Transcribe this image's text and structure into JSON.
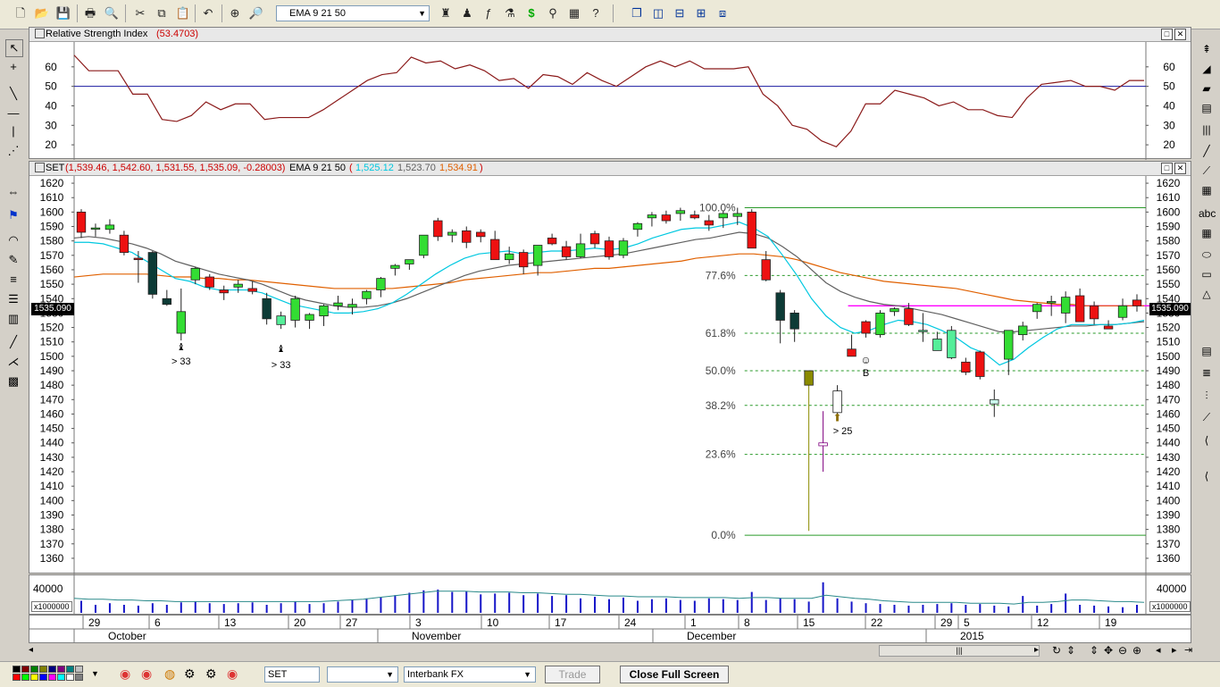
{
  "toolbar": {
    "indicator_combo_value": "EMA 9 21 50"
  },
  "rsi_pane": {
    "title_prefix": "Relative Strength Index",
    "title_value": "(53.4703)",
    "y_ticks": [
      "60",
      "50",
      "40",
      "30",
      "20"
    ],
    "ref_line": 50
  },
  "price_pane": {
    "title_symbol": "SET",
    "title_ohlc": "(1,539.46, 1,542.60, 1,531.55, 1,535.09, -0.28003)",
    "title_ema_label": "EMA 9 21 50",
    "title_ema_open": "(",
    "title_ema1": "1,525.12",
    "title_ema2": "1,523.70",
    "title_ema3": "1,534.91",
    "title_ema_close": ")",
    "current_price": "1535.090",
    "y_ticks": [
      "1620",
      "1610",
      "1600",
      "1590",
      "1580",
      "1570",
      "1560",
      "1550",
      "1540",
      "1530",
      "1520",
      "1510",
      "1500",
      "1490",
      "1480",
      "1470",
      "1460",
      "1450",
      "1440",
      "1430",
      "1420",
      "1410",
      "1400",
      "1390",
      "1380",
      "1370",
      "1360"
    ],
    "fib_labels": [
      "100.0%",
      "77.6%",
      "61.8%",
      "50.0%",
      "38.2%",
      "23.6%",
      "0.0%"
    ],
    "annotations": [
      "> 33",
      "> 33",
      "B",
      "> 25"
    ]
  },
  "volume_pane": {
    "y_tick": "40000",
    "multiplier": "x1000000"
  },
  "date_axis": {
    "days": [
      "29",
      "6",
      "13",
      "20",
      "27",
      "3",
      "10",
      "17",
      "24",
      "1",
      "8",
      "15",
      "22",
      "29",
      "5",
      "12",
      "19"
    ],
    "months": [
      "October",
      "November",
      "December",
      "2015"
    ]
  },
  "bottombar": {
    "symbol": "SET",
    "period": "",
    "source": "Interbank FX",
    "trade_label": "Trade",
    "close_full_screen_label": "Close Full Screen"
  },
  "colors": {
    "rsi_line": "#8b1a1a",
    "ema9": "#00c8e0",
    "ema21": "#606060",
    "ema50": "#e06000",
    "up_candle": "#33dd33",
    "down_candle": "#ee1111",
    "fib_line": "#2a9a2a",
    "volume_bar": "#1515c8",
    "volume_avg": "#2a8a8a"
  },
  "chart_data": {
    "type": "line",
    "title": "SET",
    "rsi": [
      66,
      58,
      58,
      58,
      46,
      46,
      33,
      32,
      35,
      42,
      38,
      41,
      41,
      33,
      34,
      34,
      34,
      38,
      43,
      48,
      53,
      56,
      57,
      65,
      62,
      63,
      59,
      61,
      58,
      53,
      54,
      49,
      56,
      55,
      51,
      57,
      53,
      50,
      55,
      60,
      63,
      60,
      63,
      59,
      59,
      59,
      60,
      46,
      40,
      30,
      28,
      22,
      19,
      27,
      41,
      41,
      48,
      46,
      44,
      40,
      42,
      38,
      38,
      35,
      34,
      44,
      51,
      52,
      53,
      50,
      50,
      48,
      53,
      53
    ],
    "price_ohlc": [
      [
        1600,
        1602,
        1582,
        1586
      ],
      [
        1589,
        1592,
        1583,
        1589
      ],
      [
        1588,
        1595,
        1585,
        1591
      ],
      [
        1584,
        1587,
        1570,
        1572
      ],
      [
        1568,
        1573,
        1551,
        1567
      ],
      [
        1572,
        1573,
        1540,
        1543
      ],
      [
        1540,
        1546,
        1535,
        1536
      ],
      [
        1516,
        1547,
        1511,
        1531
      ],
      [
        1553,
        1562,
        1550,
        1561
      ],
      [
        1555,
        1557,
        1546,
        1548
      ],
      [
        1546,
        1549,
        1539,
        1544
      ],
      [
        1548,
        1553,
        1544,
        1550
      ],
      [
        1547,
        1552,
        1543,
        1545
      ],
      [
        1540,
        1544,
        1522,
        1526
      ],
      [
        1522,
        1531,
        1519,
        1528
      ],
      [
        1525,
        1542,
        1520,
        1540
      ],
      [
        1525,
        1530,
        1519,
        1529
      ],
      [
        1528,
        1536,
        1521,
        1535
      ],
      [
        1535,
        1542,
        1532,
        1537
      ],
      [
        1534,
        1540,
        1529,
        1536
      ],
      [
        1540,
        1546,
        1536,
        1545
      ],
      [
        1546,
        1555,
        1541,
        1554
      ],
      [
        1561,
        1564,
        1556,
        1563
      ],
      [
        1564,
        1567,
        1560,
        1567
      ],
      [
        1570,
        1584,
        1568,
        1584
      ],
      [
        1594,
        1596,
        1580,
        1583
      ],
      [
        1584,
        1588,
        1579,
        1586
      ],
      [
        1587,
        1590,
        1575,
        1579
      ],
      [
        1586,
        1588,
        1579,
        1583
      ],
      [
        1581,
        1587,
        1567,
        1567
      ],
      [
        1567,
        1576,
        1564,
        1571
      ],
      [
        1572,
        1574,
        1557,
        1562
      ],
      [
        1563,
        1566,
        1556,
        1577
      ],
      [
        1582,
        1585,
        1577,
        1578
      ],
      [
        1576,
        1580,
        1567,
        1569
      ],
      [
        1569,
        1585,
        1568,
        1578
      ],
      [
        1585,
        1587,
        1575,
        1578
      ],
      [
        1580,
        1583,
        1567,
        1569
      ],
      [
        1570,
        1582,
        1568,
        1580
      ],
      [
        1588,
        1593,
        1583,
        1592
      ],
      [
        1596,
        1600,
        1590,
        1598
      ],
      [
        1598,
        1601,
        1592,
        1594
      ],
      [
        1599,
        1603,
        1594,
        1601
      ],
      [
        1598,
        1601,
        1595,
        1596
      ],
      [
        1594,
        1598,
        1587,
        1591
      ],
      [
        1596,
        1601,
        1589,
        1599
      ],
      [
        1597,
        1603,
        1591,
        1599
      ],
      [
        1600,
        1602,
        1583,
        1575
      ],
      [
        1567,
        1573,
        1552,
        1553
      ],
      [
        1544,
        1546,
        1509,
        1525
      ],
      [
        1530,
        1532,
        1510,
        1519
      ],
      [
        1490,
        1489,
        1379,
        1480
      ],
      [
        1440,
        1462,
        1420,
        1438
      ],
      [
        1461,
        1480,
        1456,
        1476
      ],
      [
        1505,
        1515,
        1500,
        1500
      ],
      [
        1524,
        1525,
        1513,
        1516
      ],
      [
        1515,
        1532,
        1513,
        1530
      ],
      [
        1531,
        1534,
        1528,
        1533
      ],
      [
        1533,
        1537,
        1521,
        1522
      ],
      [
        1518,
        1530,
        1510,
        1518
      ],
      [
        1512,
        1517,
        1505,
        1504
      ],
      [
        1518,
        1521,
        1498,
        1499
      ],
      [
        1496,
        1499,
        1487,
        1489
      ],
      [
        1503,
        1504,
        1484,
        1486
      ],
      [
        1470,
        1477,
        1458,
        1467
      ],
      [
        1498,
        1518,
        1487,
        1518
      ],
      [
        1515,
        1524,
        1511,
        1521
      ],
      [
        1531,
        1537,
        1526,
        1536
      ],
      [
        1537,
        1542,
        1528,
        1538
      ],
      [
        1530,
        1545,
        1523,
        1541
      ],
      [
        1542,
        1547,
        1530,
        1524
      ],
      [
        1535,
        1538,
        1522,
        1526
      ],
      [
        1521,
        1525,
        1519,
        1519
      ],
      [
        1527,
        1540,
        1525,
        1535
      ],
      [
        1539,
        1543,
        1531,
        1535
      ]
    ],
    "fib_levels": [
      1603,
      1556,
      1516,
      1490,
      1466,
      1432,
      1376
    ],
    "fib_percent": [
      100.0,
      77.6,
      61.8,
      50.0,
      38.2,
      23.6,
      0.0
    ],
    "magenta_line": 1535,
    "ema9": [
      1579,
      1579,
      1578,
      1575,
      1572,
      1566,
      1560,
      1554,
      1552,
      1548,
      1546,
      1546,
      1546,
      1544,
      1540,
      1536,
      1534,
      1532,
      1530,
      1530,
      1531,
      1533,
      1537,
      1543,
      1550,
      1557,
      1563,
      1568,
      1571,
      1572,
      1573,
      1571,
      1572,
      1573,
      1573,
      1574,
      1575,
      1574,
      1575,
      1578,
      1582,
      1585,
      1588,
      1589,
      1589,
      1591,
      1593,
      1589,
      1583,
      1570,
      1556,
      1540,
      1528,
      1520,
      1516,
      1518,
      1522,
      1525,
      1524,
      1522,
      1518,
      1513,
      1506,
      1502,
      1494,
      1498,
      1506,
      1513,
      1519,
      1522,
      1522,
      1522,
      1522,
      1523,
      1525
    ],
    "ema21": [
      1582,
      1583,
      1582,
      1580,
      1578,
      1575,
      1571,
      1566,
      1563,
      1560,
      1557,
      1555,
      1553,
      1550,
      1546,
      1542,
      1539,
      1537,
      1535,
      1534,
      1534,
      1535,
      1537,
      1540,
      1544,
      1548,
      1552,
      1556,
      1559,
      1561,
      1563,
      1564,
      1565,
      1566,
      1567,
      1568,
      1569,
      1570,
      1571,
      1573,
      1575,
      1577,
      1579,
      1581,
      1582,
      1584,
      1586,
      1585,
      1582,
      1576,
      1569,
      1560,
      1551,
      1545,
      1541,
      1538,
      1536,
      1535,
      1533,
      1531,
      1529,
      1526,
      1523,
      1520,
      1517,
      1517,
      1518,
      1519,
      1520,
      1521,
      1521,
      1522,
      1522,
      1523,
      1524
    ],
    "ema50": [
      1555,
      1556,
      1557,
      1557,
      1557,
      1557,
      1556,
      1555,
      1555,
      1554,
      1554,
      1553,
      1553,
      1552,
      1551,
      1550,
      1549,
      1548,
      1547,
      1547,
      1547,
      1547,
      1547,
      1548,
      1549,
      1550,
      1551,
      1553,
      1554,
      1555,
      1556,
      1557,
      1558,
      1558,
      1559,
      1560,
      1561,
      1561,
      1562,
      1563,
      1564,
      1565,
      1566,
      1568,
      1569,
      1570,
      1571,
      1571,
      1570,
      1569,
      1567,
      1564,
      1561,
      1558,
      1556,
      1554,
      1552,
      1551,
      1550,
      1549,
      1548,
      1547,
      1545,
      1543,
      1541,
      1539,
      1538,
      1537,
      1536,
      1536,
      1535,
      1535,
      1535,
      1535,
      1535
    ],
    "volume": [
      15,
      10,
      12,
      10,
      9,
      12,
      10,
      13,
      14,
      12,
      11,
      12,
      13,
      10,
      12,
      14,
      11,
      12,
      14,
      16,
      18,
      19,
      22,
      25,
      28,
      29,
      26,
      27,
      23,
      24,
      25,
      22,
      24,
      21,
      22,
      18,
      20,
      17,
      19,
      15,
      17,
      18,
      16,
      15,
      18,
      17,
      16,
      26,
      16,
      18,
      17,
      14,
      38,
      18,
      14,
      12,
      11,
      10,
      9,
      10,
      11,
      12,
      10,
      11,
      9,
      8,
      21,
      9,
      11,
      24,
      10,
      9,
      8,
      7,
      10
    ],
    "volume_avg": [
      18,
      17,
      17,
      16,
      16,
      15,
      15,
      14,
      14,
      14,
      14,
      14,
      14,
      14,
      14,
      14,
      14,
      14,
      15,
      16,
      17,
      19,
      21,
      23,
      25,
      27,
      27,
      27,
      26,
      26,
      26,
      25,
      25,
      24,
      23,
      23,
      22,
      21,
      21,
      20,
      20,
      20,
      19,
      19,
      19,
      19,
      18,
      19,
      19,
      18,
      18,
      18,
      22,
      20,
      18,
      17,
      15,
      14,
      13,
      13,
      13,
      13,
      12,
      12,
      12,
      11,
      13,
      13,
      14,
      16,
      16,
      15,
      14,
      14,
      13
    ],
    "x_labels": [
      "29",
      "6",
      "13",
      "20",
      "27",
      "3",
      "10",
      "17",
      "24",
      "1",
      "8",
      "15",
      "22",
      "29",
      "5",
      "12",
      "19"
    ],
    "months": [
      "October",
      "November",
      "December",
      "2015"
    ],
    "ylim_price": [
      1355,
      1625
    ],
    "ylim_rsi": [
      15,
      70
    ]
  }
}
